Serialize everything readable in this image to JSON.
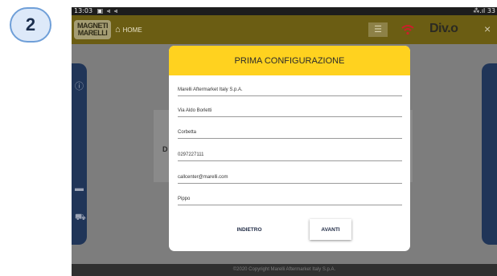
{
  "step_number": "2",
  "status_bar": {
    "time": "13:03",
    "system_icons": "▣ ⫷ ⫷",
    "battery": "⁂.ıl 33"
  },
  "top_bar": {
    "logo_text": "MAGNETI MARELLI",
    "home_label": "HOME",
    "brand_label": "Div.o",
    "close_label": "×",
    "accent_color": "#ffd21f"
  },
  "background": {
    "card_letter": "D",
    "footer_text": "©2020 Copyright Marelli Aftermarket Italy S.p.A."
  },
  "dialog": {
    "title": "PRIMA CONFIGURAZIONE",
    "fields": [
      {
        "value": "Marelli Aftermarket Italy S.p.A."
      },
      {
        "value": "Via Aldo Borletti"
      },
      {
        "value": "Corbetta"
      },
      {
        "value": "0297227111"
      },
      {
        "value": "callcenter@marelli.com"
      },
      {
        "value": "Pippo"
      }
    ],
    "back_label": "INDIETRO",
    "next_label": "AVANTI"
  }
}
